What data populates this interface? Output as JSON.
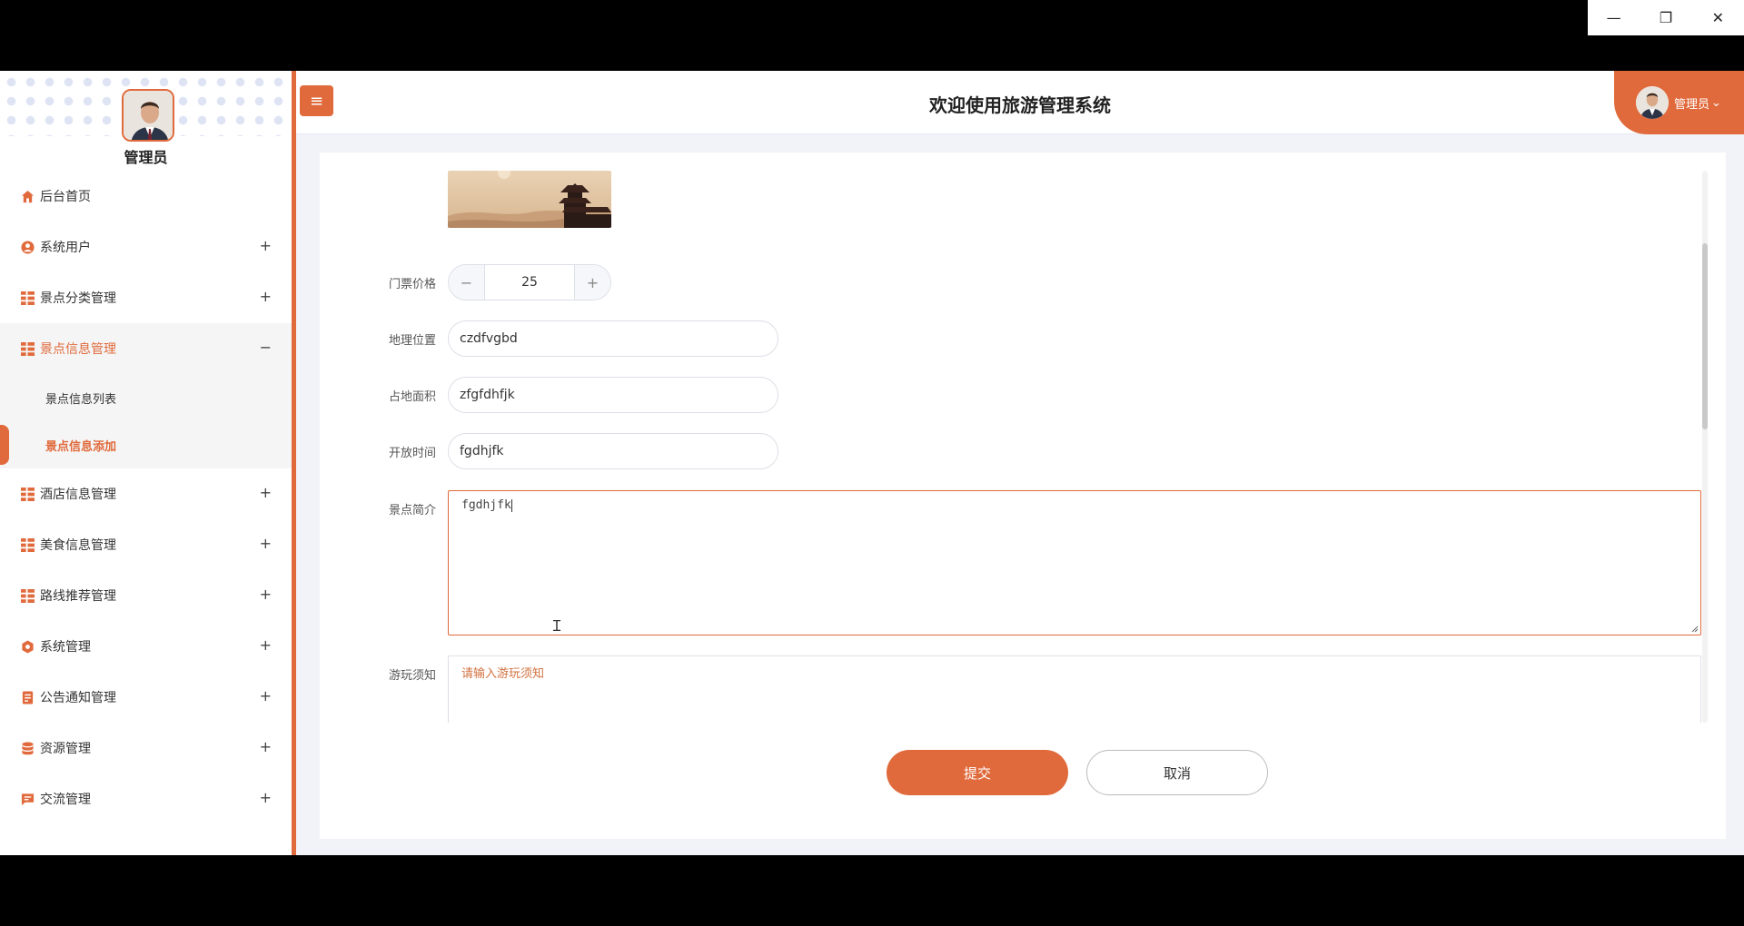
{
  "window": {
    "minimize": "—",
    "restore": "❐",
    "close": "✕"
  },
  "profile": {
    "name": "管理员"
  },
  "sidebar": {
    "items": [
      {
        "label": "后台首页",
        "icon": "home-icon",
        "toggle": ""
      },
      {
        "label": "系统用户",
        "icon": "user-circle-icon",
        "toggle": "+"
      },
      {
        "label": "景点分类管理",
        "icon": "grid-icon",
        "toggle": "+"
      },
      {
        "label": "景点信息管理",
        "icon": "grid-icon",
        "toggle": "−"
      },
      {
        "label": "酒店信息管理",
        "icon": "grid-icon",
        "toggle": "+"
      },
      {
        "label": "美食信息管理",
        "icon": "grid-icon",
        "toggle": "+"
      },
      {
        "label": "路线推荐管理",
        "icon": "grid-icon",
        "toggle": "+"
      },
      {
        "label": "系统管理",
        "icon": "gear-icon",
        "toggle": "+"
      },
      {
        "label": "公告通知管理",
        "icon": "document-icon",
        "toggle": "+"
      },
      {
        "label": "资源管理",
        "icon": "database-icon",
        "toggle": "+"
      },
      {
        "label": "交流管理",
        "icon": "chat-icon",
        "toggle": "+"
      }
    ],
    "submenu": [
      {
        "label": "景点信息列表"
      },
      {
        "label": "景点信息添加"
      }
    ]
  },
  "header": {
    "menu_toggle": "≡",
    "title": "欢迎使用旅游管理系统",
    "user": "管理员",
    "user_chevron": "⌄"
  },
  "form": {
    "price": {
      "label": "门票价格",
      "value": "25",
      "minus": "−",
      "plus": "+"
    },
    "location": {
      "label": "地理位置",
      "value": "czdfvgbd"
    },
    "area": {
      "label": "占地面积",
      "value": "zfgfdhfjk"
    },
    "open_time": {
      "label": "开放时间",
      "value": "fgdhjfk"
    },
    "intro": {
      "label": "景点简介",
      "value": "fgdhjfk"
    },
    "notice": {
      "label": "游玩须知",
      "placeholder": "请输入游玩须知"
    }
  },
  "actions": {
    "submit": "提交",
    "cancel": "取消"
  },
  "colors": {
    "accent": "#e06a3c",
    "border": "#dcdfe6"
  }
}
